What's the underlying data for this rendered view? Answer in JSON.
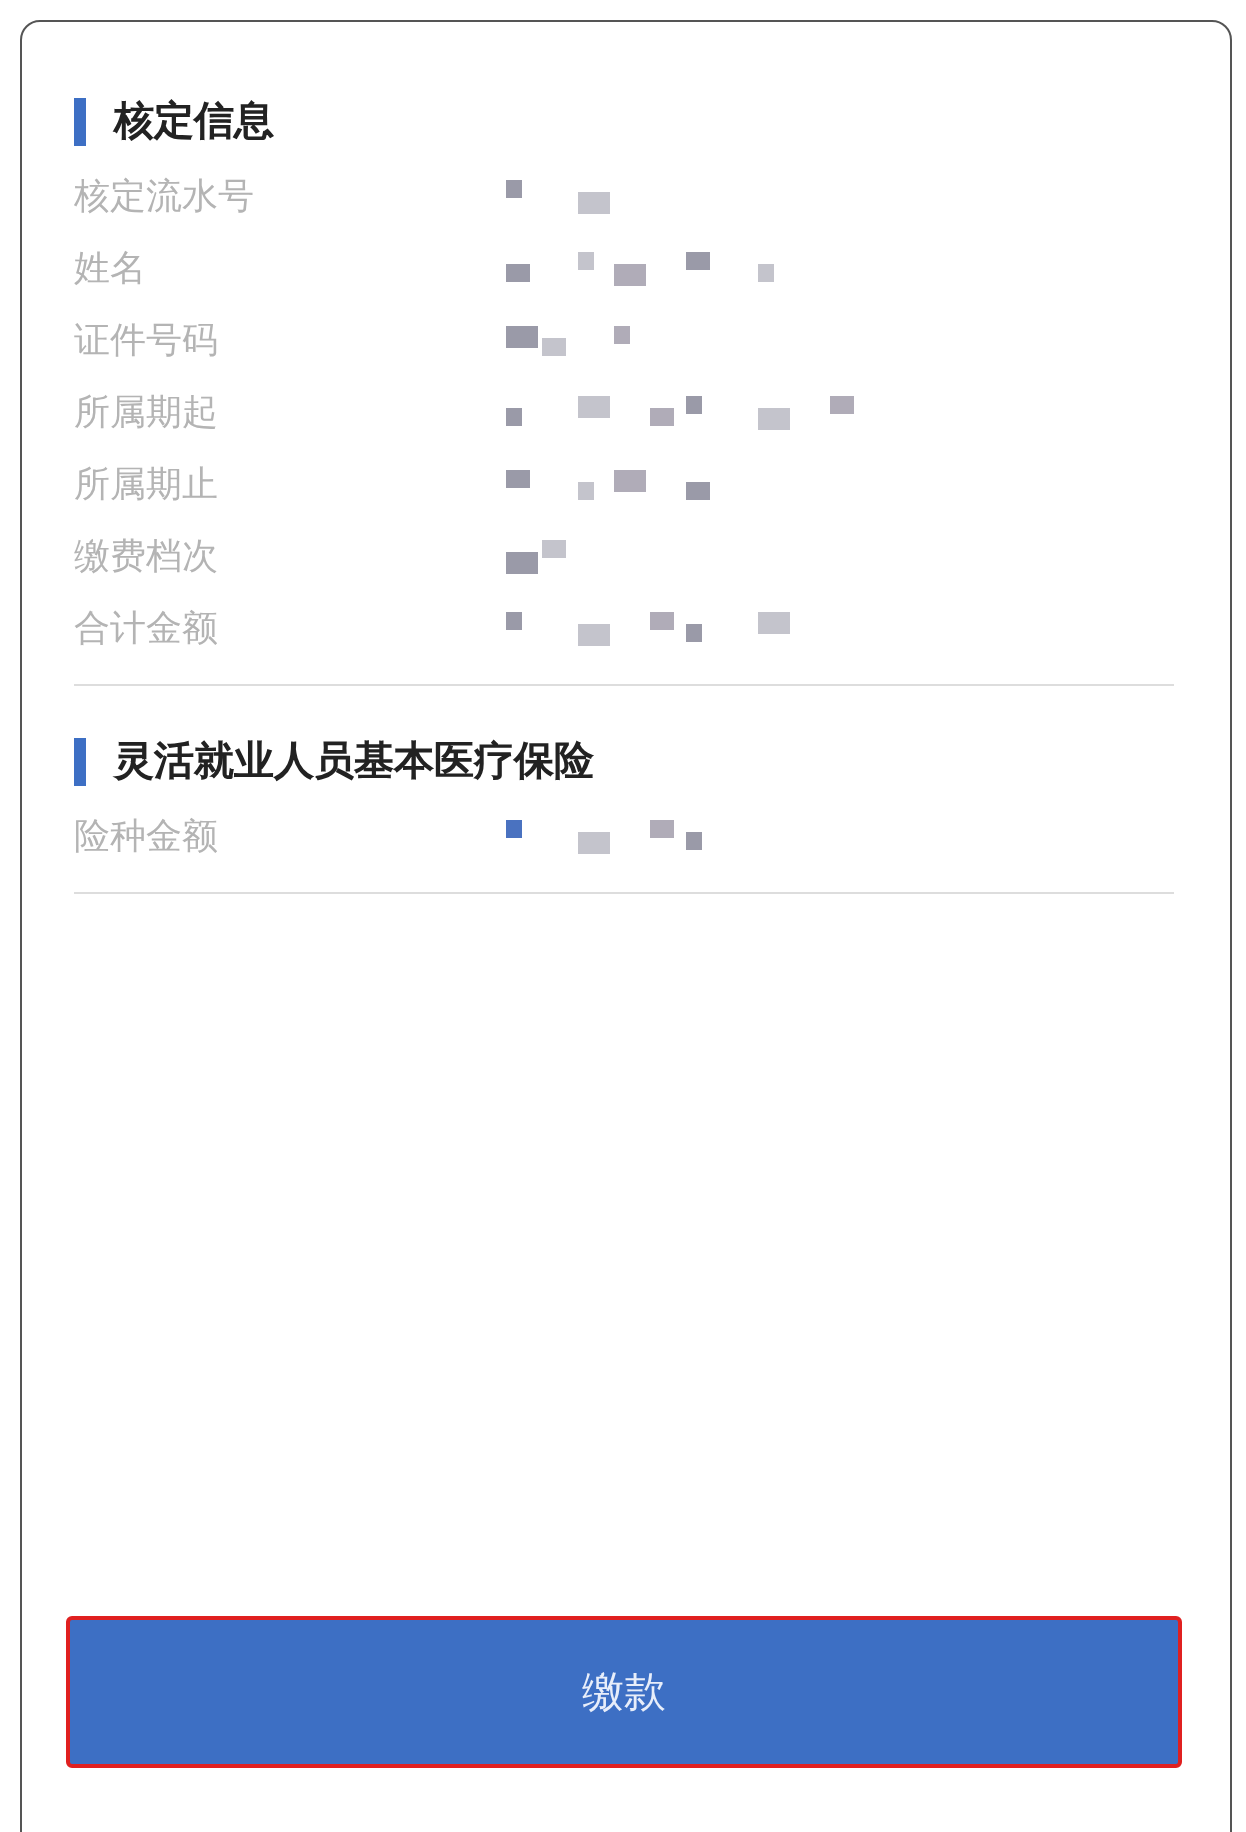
{
  "sections": [
    {
      "title": "核定信息",
      "rows": [
        {
          "label": "核定流水号"
        },
        {
          "label": "姓名"
        },
        {
          "label": "证件号码"
        },
        {
          "label": "所属期起"
        },
        {
          "label": "所属期止"
        },
        {
          "label": "缴费档次"
        },
        {
          "label": "合计金额"
        }
      ]
    },
    {
      "title": "灵活就业人员基本医疗保险",
      "rows": [
        {
          "label": "险种金额"
        }
      ]
    }
  ],
  "pay_button": {
    "label": "缴款"
  }
}
